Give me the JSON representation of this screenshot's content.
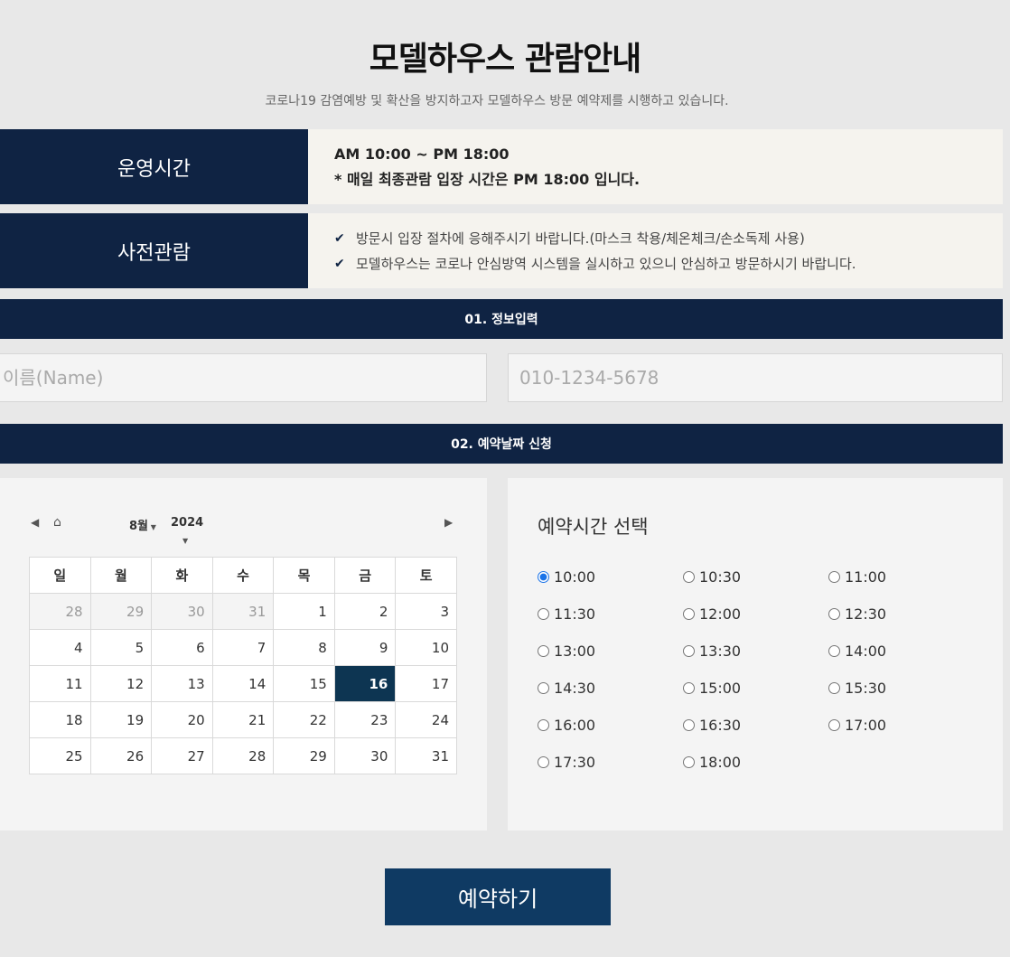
{
  "header": {
    "title": "모델하우스 관람안내",
    "subtitle": "코로나19 감염예방 및 확산을 방지하고자 모델하우스 방문 예약제를 시행하고 있습니다."
  },
  "hours": {
    "label": "운영시간",
    "line": "AM 10:00 ~ PM 18:00",
    "note": "* 매일 최종관람 입장 시간은 PM 18:00 입니다."
  },
  "pre_visit": {
    "label": "사전관람",
    "items": [
      "방문시 입장 절차에 응해주시기 바랍니다.(마스크 착용/체온체크/손소독제 사용)",
      "모델하우스는 코로나 안심방역 시스템을 실시하고 있으니 안심하고 방문하시기 바랍니다."
    ]
  },
  "step1": {
    "label": "01. 정보입력",
    "name_placeholder": "이름(Name)",
    "phone_placeholder": "010-1234-5678"
  },
  "step2": {
    "label": "02. 예약날짜 신청"
  },
  "calendar": {
    "month": "8월",
    "year": "2024",
    "weekdays": [
      "일",
      "월",
      "화",
      "수",
      "목",
      "금",
      "토"
    ],
    "selected_day": "16",
    "weeks": [
      [
        "28",
        "29",
        "30",
        "31",
        "1",
        "2",
        "3"
      ],
      [
        "4",
        "5",
        "6",
        "7",
        "8",
        "9",
        "10"
      ],
      [
        "11",
        "12",
        "13",
        "14",
        "15",
        "16",
        "17"
      ],
      [
        "18",
        "19",
        "20",
        "21",
        "22",
        "23",
        "24"
      ],
      [
        "25",
        "26",
        "27",
        "28",
        "29",
        "30",
        "31"
      ]
    ]
  },
  "time_select": {
    "title": "예약시간 선택",
    "selected": "10:00",
    "options": [
      "10:00",
      "10:30",
      "11:00",
      "11:30",
      "12:00",
      "12:30",
      "13:00",
      "13:30",
      "14:00",
      "14:30",
      "15:00",
      "15:30",
      "16:00",
      "16:30",
      "17:00",
      "17:30",
      "18:00"
    ]
  },
  "submit": {
    "label": "예약하기"
  },
  "colors": {
    "navy": "#0f2343",
    "selected_day": "#0d3552",
    "button": "#0f3a63"
  },
  "icons": {
    "prev": "triangle-left-icon",
    "home": "home-icon",
    "next": "triangle-right-icon",
    "check": "check-icon"
  }
}
